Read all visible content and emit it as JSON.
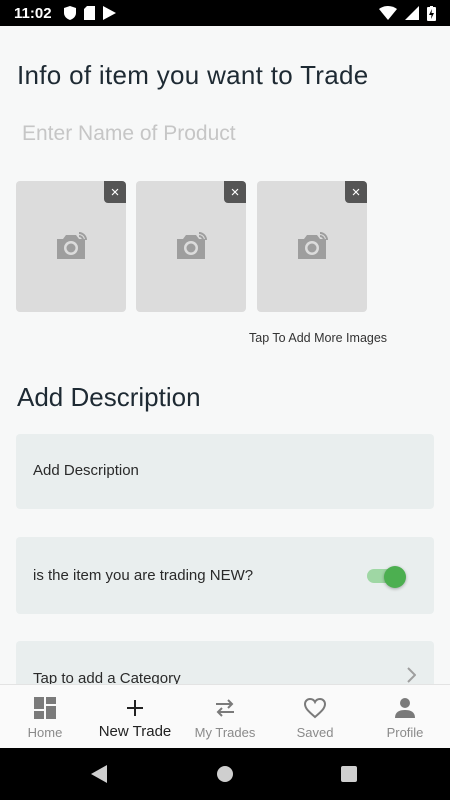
{
  "status": {
    "time": "11:02"
  },
  "page": {
    "title": "Info of item you want to Trade",
    "product_placeholder": "Enter Name of Product",
    "add_more_images": "Tap To Add More Images",
    "description_section_title": "Add Description",
    "description_placeholder": "Add Description",
    "new_question": "is the item you are trading NEW?",
    "new_toggle_on": true,
    "category_label": "Tap to add a Category"
  },
  "images": [
    {
      "close": "×"
    },
    {
      "close": "×"
    },
    {
      "close": "×"
    }
  ],
  "nav": {
    "home": "Home",
    "new_trade": "New Trade",
    "my_trades": "My Trades",
    "saved": "Saved",
    "profile": "Profile"
  },
  "colors": {
    "toggle_thumb": "#4caf50",
    "toggle_track": "#9fd7a4",
    "card_bg": "#e9eeee"
  }
}
